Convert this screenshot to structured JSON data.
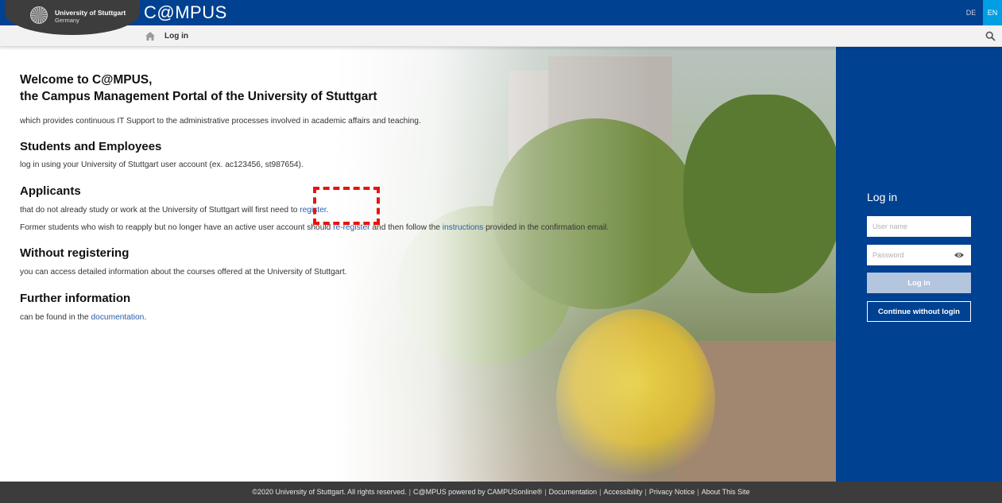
{
  "header": {
    "university_name": "University of Stuttgart",
    "country": "Germany",
    "app_title": "C@MPUS",
    "languages": [
      "DE",
      "EN"
    ],
    "active_language": "EN"
  },
  "breadcrumb": {
    "current": "Log in"
  },
  "content": {
    "welcome_line1": "Welcome to C@MPUS,",
    "welcome_line2": "the Campus Management Portal of the University of Stuttgart",
    "intro": "which provides continuous IT Support to the administrative processes involved in academic affairs and teaching.",
    "students_heading": "Students and Employees",
    "students_text": "log in using your University of Stuttgart user account (ex. ac123456, st987654).",
    "applicants_heading": "Applicants",
    "applicants_text_before": "that do not already study or work at the University of Stuttgart will first need to ",
    "applicants_link": "register",
    "applicants_text_after": ".",
    "former_text_before": "Former students who wish to reapply but no longer have an active user account should ",
    "former_link1": "re-register",
    "former_text_middle": " and then follow the ",
    "former_link2": "instructions",
    "former_text_after": " provided in the confirmation email.",
    "without_heading": "Without registering",
    "without_text": "you can access detailed information about the courses offered at the University of Stuttgart.",
    "further_heading": "Further information",
    "further_text_before": "can be found in the ",
    "further_link": "documentation",
    "further_text_after": "."
  },
  "login": {
    "title": "Log in",
    "username_placeholder": "User name",
    "password_placeholder": "Password",
    "login_button": "Log in",
    "guest_button": "Continue without login"
  },
  "footer": {
    "copyright": "©2020 University of Stuttgart. All rights reserved.",
    "powered": "C@MPUS powered by CAMPUSonline®",
    "links": [
      "Documentation",
      "Accessibility",
      "Privacy Notice",
      "About This Site"
    ]
  },
  "colors": {
    "brand_blue": "#004191",
    "active_lang": "#009fe3",
    "link": "#2a5ca8",
    "footer_bg": "#3c3c3c",
    "annotation": "#e8130f"
  },
  "icons": [
    "home-icon",
    "search-icon",
    "eye-icon",
    "university-seal-icon"
  ]
}
